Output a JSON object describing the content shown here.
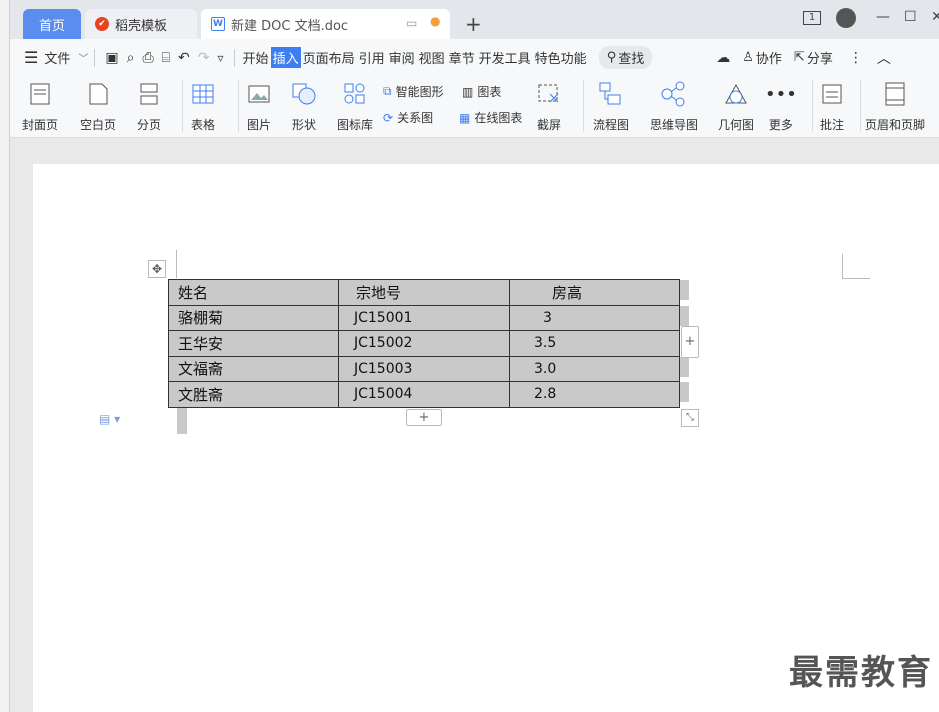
{
  "tabs": {
    "home": "首页",
    "template": "稻壳模板",
    "doc": "新建 DOC 文档.doc",
    "add": "+"
  },
  "window": {
    "page_count": "1"
  },
  "menu": {
    "file": "文件",
    "items": [
      "开始",
      "插入",
      "页面布局",
      "引用",
      "审阅",
      "视图",
      "章节",
      "开发工具",
      "特色功能"
    ],
    "active": "插入",
    "search": "查找",
    "collab": "协作",
    "share": "分享"
  },
  "ribbon": {
    "cover": "封面页",
    "blank": "空白页",
    "break": "分页",
    "table": "表格",
    "picture": "图片",
    "shape": "形状",
    "iconlib": "图标库",
    "smartart": "智能图形",
    "chart": "图表",
    "relation": "关系图",
    "onlinechart": "在线图表",
    "screenshot": "截屏",
    "flowchart": "流程图",
    "mindmap": "思维导图",
    "geometry": "几何图",
    "more": "更多",
    "comment": "批注",
    "headerfooter": "页眉和页脚"
  },
  "table": {
    "headers": [
      "姓名",
      "宗地号",
      "房高"
    ],
    "rows": [
      [
        "骆棚菊",
        "JC15001",
        "3"
      ],
      [
        "王华安",
        "JC15002",
        "3.5"
      ],
      [
        "文福斋",
        "JC15003",
        "3.0"
      ],
      [
        "文胜斋",
        "JC15004",
        "2.8"
      ]
    ]
  },
  "watermark": "最需教育",
  "colors": {
    "accent": "#5b8def",
    "insert_highlight": "#3d7ff2",
    "table_fill": "#c9c9c9"
  }
}
